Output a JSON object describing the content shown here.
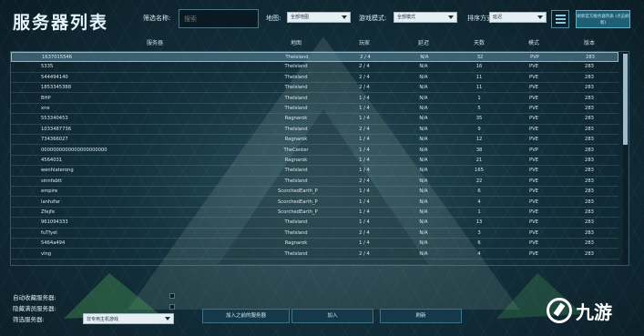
{
  "window": {
    "title": "服务器列表"
  },
  "filters": {
    "name_label": "筛选名称:",
    "search_placeholder": "搜索",
    "map_label": "地图:",
    "map_value": "全部地图",
    "mode_label": "游戏模式:",
    "mode_value": "全部模式",
    "sort_label": "排序方式:",
    "sort_value": "延迟",
    "refresh_button": "刷新官方服务器列表 (点击刷新)"
  },
  "table": {
    "columns": [
      "服务器",
      "地图",
      "玩家",
      "延迟",
      "天数",
      "模式",
      "版本"
    ],
    "rows": [
      [
        "1637015546",
        "TheIsland",
        "2 / 4",
        "N/A",
        "32",
        "PVP",
        "283"
      ],
      [
        "5335",
        "TheIsland",
        "2 / 4",
        "N/A",
        "16",
        "PVE",
        "283"
      ],
      [
        "544494140",
        "TheIsland",
        "2 / 4",
        "N/A",
        "11",
        "PVE",
        "283"
      ],
      [
        "1853345388",
        "TheIsland",
        "2 / 4",
        "N/A",
        "11",
        "PVE",
        "283"
      ],
      [
        "BHP",
        "TheIsland",
        "1 / 4",
        "N/A",
        "1",
        "PVE",
        "283"
      ],
      [
        "xne",
        "TheIsland",
        "1 / 4",
        "N/A",
        "5",
        "PVE",
        "283"
      ],
      [
        "553340453",
        "Ragnarok",
        "1 / 4",
        "N/A",
        "35",
        "PVE",
        "283"
      ],
      [
        "1033487736",
        "TheIsland",
        "2 / 4",
        "N/A",
        "9",
        "PVE",
        "283"
      ],
      [
        "734366027",
        "Ragnarok",
        "1 / 4",
        "N/A",
        "12",
        "PVE",
        "283"
      ],
      [
        "0000000000000000000000",
        "TheCenter",
        "1 / 4",
        "N/A",
        "38",
        "PVP",
        "283"
      ],
      [
        "4564031",
        "Ragnarok",
        "1 / 4",
        "N/A",
        "21",
        "PVE",
        "283"
      ],
      [
        "wenhlaterong",
        "TheIsland",
        "1 / 4",
        "N/A",
        "165",
        "PVE",
        "283"
      ],
      [
        "sinnfabtt",
        "TheIsland",
        "2 / 4",
        "N/A",
        "22",
        "PVE",
        "283"
      ],
      [
        "empire",
        "ScorchedEarth_P",
        "1 / 4",
        "N/A",
        "6",
        "PVE",
        "283"
      ],
      [
        "lanhzfar",
        "ScorchedEarth_P",
        "1 / 4",
        "N/A",
        "4",
        "PVE",
        "283"
      ],
      [
        "Zfejfe",
        "ScorchedEarth_P",
        "1 / 4",
        "N/A",
        "1",
        "PVE",
        "283"
      ],
      [
        "961094333",
        "TheIsland",
        "1 / 4",
        "N/A",
        "13",
        "PVE",
        "283"
      ],
      [
        "fuTfyel",
        "TheIsland",
        "2 / 4",
        "N/A",
        "3",
        "PVE",
        "283"
      ],
      [
        "5464a494",
        "Ragnarok",
        "1 / 4",
        "N/A",
        "6",
        "PVE",
        "283"
      ],
      [
        "ving",
        "TheIsland",
        "2 / 4",
        "N/A",
        "4",
        "PVE",
        "283"
      ]
    ]
  },
  "options": {
    "auto_fav_label": "自动收藏服务器:",
    "hide_full_label": "隐藏满员服务器:",
    "filter_label": "筛选服务器:",
    "filter_value": "非专用主机游戏"
  },
  "actions": {
    "join_last": "加入之前的服务器",
    "join": "加入",
    "refresh": "刷新"
  },
  "watermark": {
    "text": "九游"
  }
}
